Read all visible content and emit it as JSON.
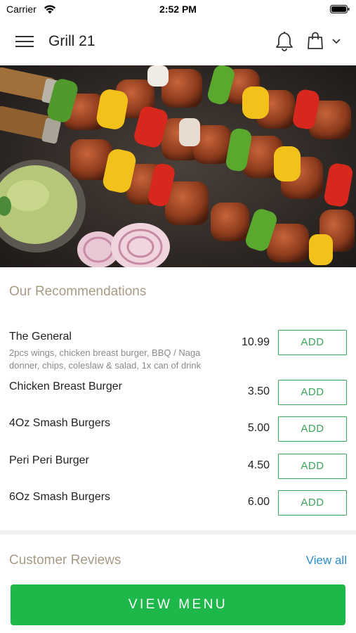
{
  "status_bar": {
    "carrier": "Carrier",
    "time": "2:52 PM"
  },
  "header": {
    "title": "Grill 21"
  },
  "recommendations": {
    "title": "Our Recommendations",
    "add_label": "ADD",
    "items": [
      {
        "name": "The General",
        "description": "2pcs wings, chicken breast burger, BBQ / Naga donner, chips, coleslaw & salad, 1x can of drink",
        "price": "10.99"
      },
      {
        "name": "Chicken Breast Burger",
        "description": "",
        "price": "3.50"
      },
      {
        "name": "4Oz Smash Burgers",
        "description": "",
        "price": "5.00"
      },
      {
        "name": "Peri Peri Burger",
        "description": "",
        "price": "4.50"
      },
      {
        "name": "6Oz Smash Burgers",
        "description": "",
        "price": "6.00"
      }
    ]
  },
  "reviews": {
    "title": "Customer Reviews",
    "view_all_label": "View all"
  },
  "footer": {
    "view_menu_label": "VIEW MENU"
  },
  "colors": {
    "accent_green": "#1eb84a",
    "add_button_green": "#3ba55c",
    "section_title": "#a89b84",
    "link_blue": "#2a8fd0"
  }
}
